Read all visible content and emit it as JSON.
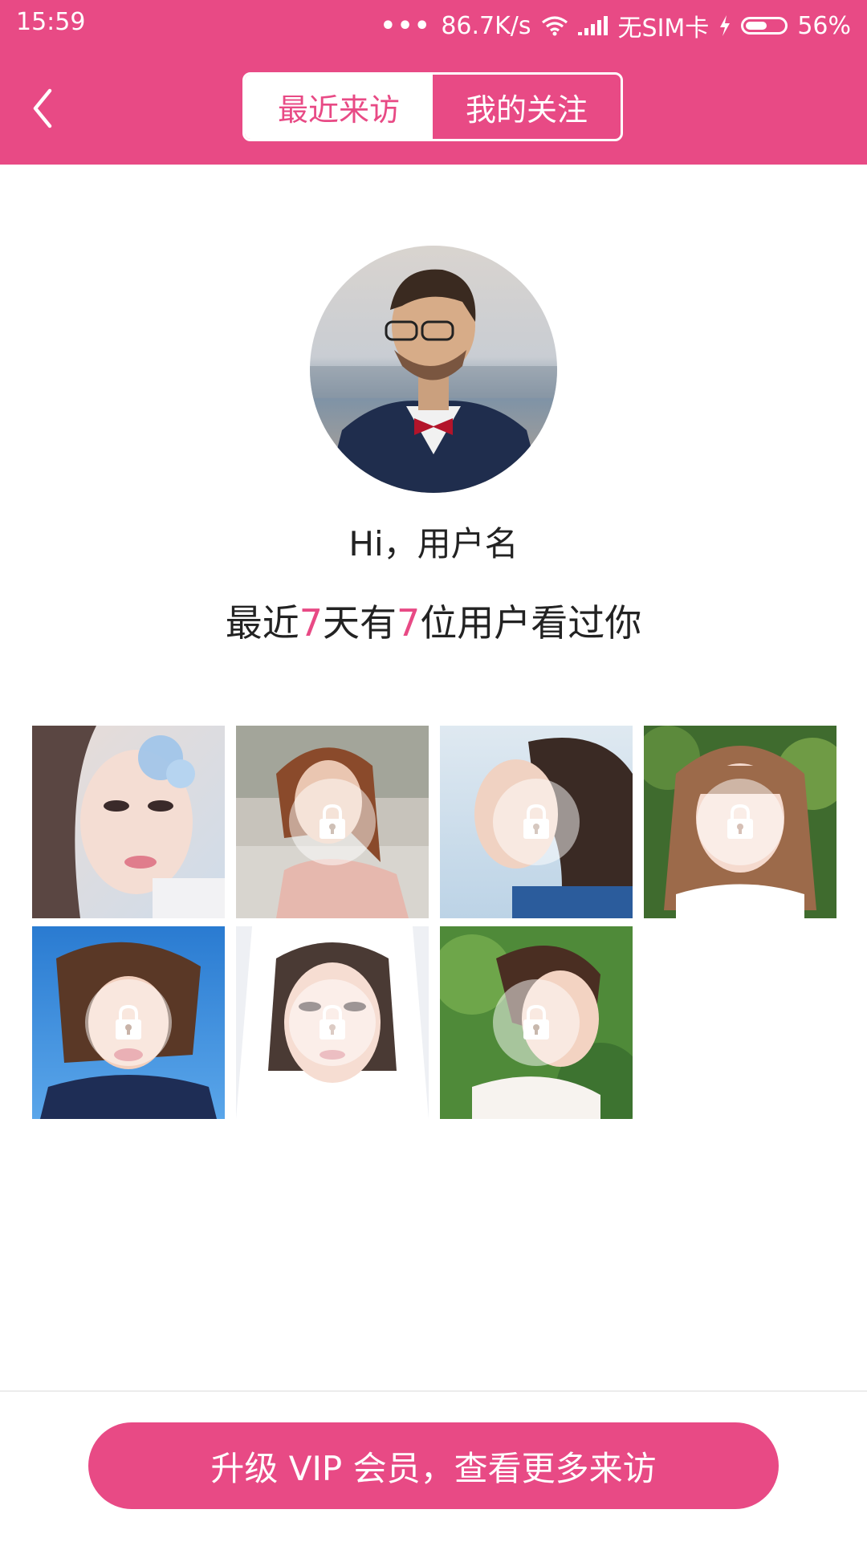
{
  "status_bar": {
    "time": "15:59",
    "net_speed": "86.7K/s",
    "sim": "无SIM卡",
    "battery": "56%",
    "battery_level": 0.56
  },
  "header": {
    "tabs": [
      {
        "label": "最近来访",
        "active": true
      },
      {
        "label": "我的关注",
        "active": false
      }
    ]
  },
  "profile": {
    "greeting": "Hi，用户名",
    "summary_prefix": "最近",
    "days": "7",
    "summary_mid": "天有",
    "visitors": "7",
    "summary_suffix": "位用户看过你"
  },
  "visitors": [
    {
      "locked": false,
      "tone": "light-blue-portrait"
    },
    {
      "locked": true,
      "tone": "street-portrait"
    },
    {
      "locked": true,
      "tone": "sky-profile"
    },
    {
      "locked": true,
      "tone": "garden-portrait"
    },
    {
      "locked": true,
      "tone": "blue-sky-portrait"
    },
    {
      "locked": true,
      "tone": "winter-portrait"
    },
    {
      "locked": true,
      "tone": "green-profile"
    }
  ],
  "cta": {
    "label": "升级 VIP 会员，查看更多来访"
  },
  "colors": {
    "accent": "#e84a85",
    "text": "#222222"
  }
}
